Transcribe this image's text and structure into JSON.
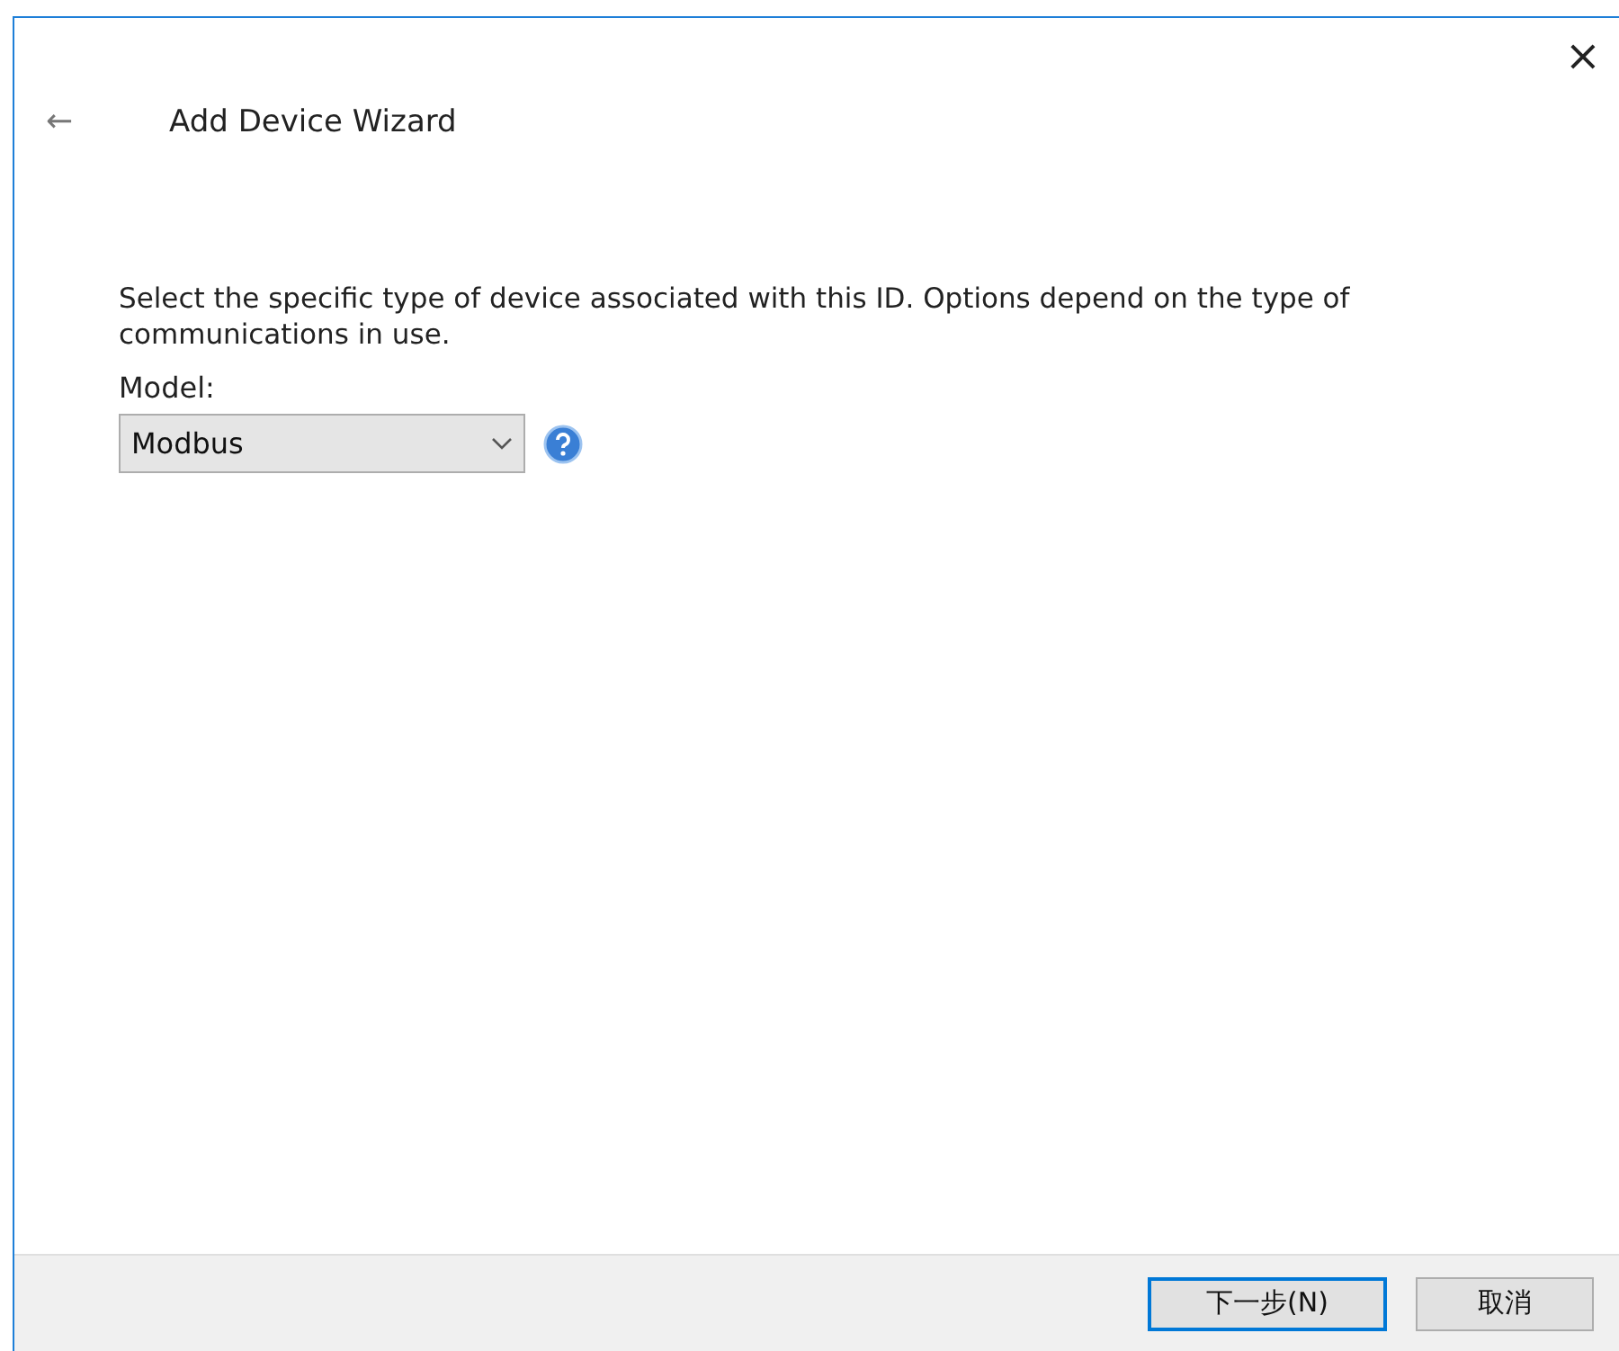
{
  "window": {
    "title": "Add Device Wizard",
    "close": "×",
    "back": "←"
  },
  "instruction": "Select the specific type of device associated with this ID. Options depend on the type of communications in use.",
  "model": {
    "label": "Model:",
    "value": "Modbus"
  },
  "buttons": [
    {
      "label": "下一步(N)",
      "default": true
    },
    {
      "label": "取消",
      "default": false
    }
  ]
}
